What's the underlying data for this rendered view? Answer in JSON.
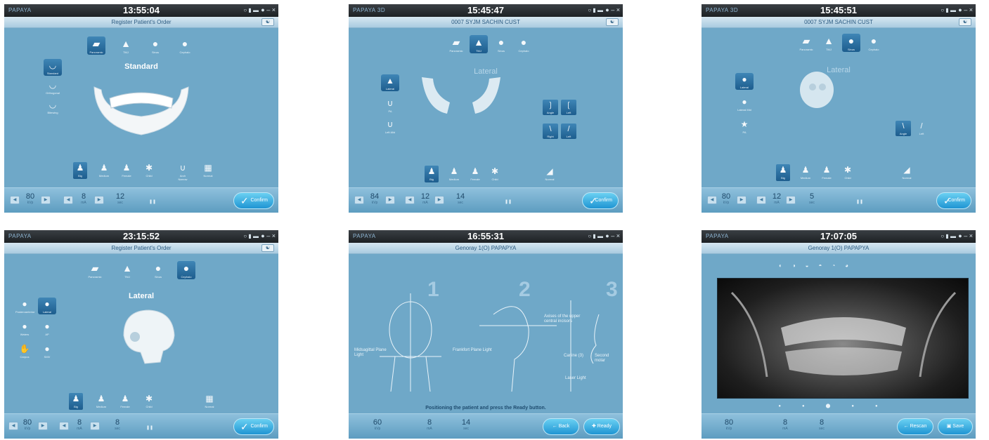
{
  "p1": {
    "clock": "13:55:04",
    "title": "Register Patient's Order",
    "heading": "Standard",
    "footer": {
      "v1": "80",
      "u1": "kVp",
      "v2": "8",
      "u2": "mA",
      "v3": "12",
      "u3": "sec",
      "confirm": "Confirm"
    }
  },
  "p2": {
    "brand": "PAPAYA 3D",
    "clock": "15:45:47",
    "title": "0007  SYJM  SACHIN CUST",
    "heading": "Lateral",
    "footer": {
      "v1": "84",
      "u1": "kVp",
      "v2": "12",
      "u2": "mA",
      "v3": "14",
      "u3": "sec",
      "confirm": "Confirm"
    }
  },
  "p3": {
    "brand": "PAPAYA 3D",
    "clock": "15:45:51",
    "title": "0007  SYJM  SACHIN CUST",
    "heading": "Lateral",
    "footer": {
      "v1": "80",
      "u1": "kVp",
      "v2": "12",
      "u2": "mA",
      "v3": "5",
      "u3": "sec",
      "confirm": "Confirm"
    }
  },
  "p4": {
    "clock": "23:15:52",
    "title": "Register Patient's Order",
    "heading": "Lateral",
    "footer": {
      "v1": "80",
      "u1": "kVp",
      "v2": "8",
      "u2": "mA",
      "v3": "8",
      "u3": "sec",
      "confirm": "Confirm"
    }
  },
  "p5": {
    "clock": "16:55:31",
    "title": "Genoray  1(O)  PAPAPYA",
    "steps": [
      "1",
      "2",
      "3"
    ],
    "labels": {
      "mid": "Midsagittal Plane Light",
      "frank": "Frankfort Plane Light",
      "axes": "Axises of the upper central incisors",
      "canine": "Canine (3)",
      "second": "Second molar",
      "laser": "Laser Light"
    },
    "instruction": "Positioning the patient and press the Ready button.",
    "footer": {
      "v1": "60",
      "u1": "kVp",
      "v2": "8",
      "u2": "mA",
      "v3": "14",
      "u3": "sec",
      "back": "Back",
      "ready": "Ready"
    }
  },
  "p6": {
    "clock": "17:07:05",
    "title": "Genoray  1(O)  PAPAPYA",
    "footer": {
      "v1": "80",
      "u1": "kVp",
      "v2": "8",
      "u2": "mA",
      "v3": "8",
      "u3": "sec",
      "rescan": "Rescan",
      "save": "Save"
    }
  },
  "shared": {
    "brand": "PAPAYA",
    "win_controls": "● – ×",
    "tb_icons": "○ ▮ ▬",
    "user_icon": "user-icon",
    "top_types": [
      "Panoramic",
      "TMJ",
      "Sinus",
      "Cephalo"
    ],
    "body_types": [
      "Big",
      "Medium",
      "Female",
      "Child"
    ],
    "arch_type": "Arch Narrow",
    "normal": "Normal",
    "p1_side": [
      "Standard",
      "Orthogonal",
      "Bitewing"
    ],
    "p2_side": [
      "Lateral",
      "PA",
      "Left-Mid"
    ],
    "p3_side": [
      "Lateral",
      "Lateral Mid",
      "PA"
    ],
    "p4_side": [
      "Posteroanterior",
      "Lateral",
      "Waters",
      "AP",
      "Carpus",
      "SMV"
    ],
    "angles": [
      "Angle",
      "Left",
      "Right",
      "Left"
    ]
  },
  "colors": {
    "panel_bg": "#6fa8c8",
    "accent": "#1f95d3",
    "titlebar": "#1d2124"
  }
}
